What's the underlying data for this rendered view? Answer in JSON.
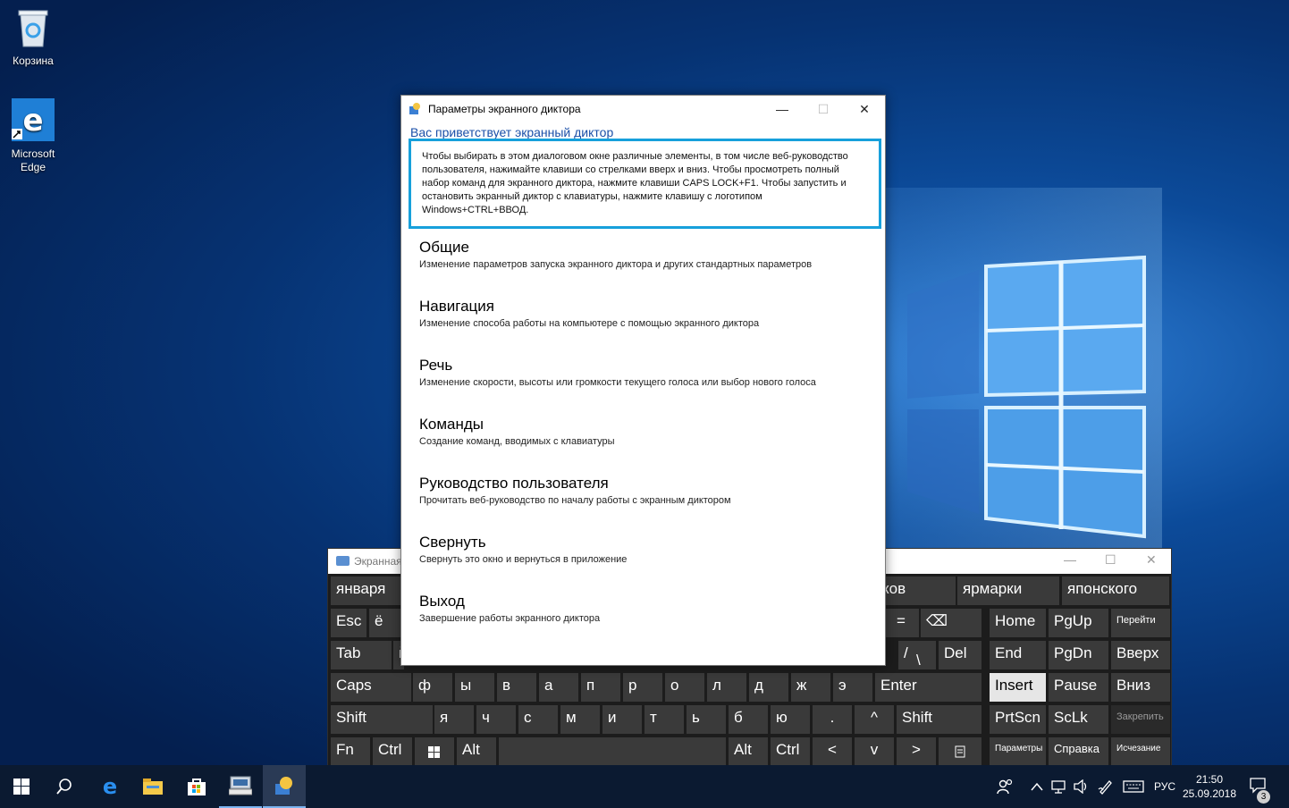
{
  "desktop": {
    "icons": [
      {
        "label": "Корзина"
      },
      {
        "label": "Microsoft Edge"
      }
    ]
  },
  "narrator": {
    "title": "Параметры экранного диктора",
    "welcome": "Вас приветствует экранный диктор",
    "intro": "Чтобы выбирать в этом диалоговом окне различные элементы, в том числе веб-руководство пользователя, нажимайте клавиши со стрелками вверх и вниз. Чтобы просмотреть полный набор команд для экранного диктора, нажмите клавиши CAPS LOCK+F1. Чтобы запустить и остановить экранный диктор с клавиатуры, нажмите клавишу с логотипом Windows+CTRL+ВВОД.",
    "items": [
      {
        "title": "Общие",
        "desc": "Изменение параметров запуска экранного диктора и других стандартных параметров"
      },
      {
        "title": "Навигация",
        "desc": "Изменение способа работы на компьютере с помощью экранного диктора"
      },
      {
        "title": "Речь",
        "desc": "Изменение скорости, высоты или громкости текущего голоса или выбор нового голоса"
      },
      {
        "title": "Команды",
        "desc": "Создание команд, вводимых с клавиатуры"
      },
      {
        "title": "Руководство пользователя",
        "desc": "Прочитать веб-руководство по началу работы с экранным диктором"
      },
      {
        "title": "Свернуть",
        "desc": "Свернуть это окно и вернуться в приложение"
      },
      {
        "title": "Выход",
        "desc": "Завершение работы экранного диктора"
      }
    ],
    "minimize": "—",
    "maximize": "☐",
    "close": "✕"
  },
  "keyboard": {
    "title": "Экранная",
    "predictions": [
      "января",
      "ков",
      "ярмарки",
      "японского"
    ],
    "row1": [
      "Esc",
      "ё",
      "=",
      "⌫"
    ],
    "row2": [
      "Tab",
      "й",
      "/",
      "\\",
      "Del"
    ],
    "row3": [
      "Caps",
      "ф",
      "ы",
      "в",
      "а",
      "п",
      "р",
      "о",
      "л",
      "д",
      "ж",
      "э",
      "Enter"
    ],
    "row4": [
      "Shift",
      "я",
      "ч",
      "с",
      "м",
      "и",
      "т",
      "ь",
      "б",
      "ю",
      ".",
      "^",
      "Shift"
    ],
    "row5": [
      "Fn",
      "Ctrl",
      "Alt",
      "Alt",
      "Ctrl",
      "<",
      "v",
      ">"
    ],
    "nav": {
      "home": "Home",
      "pgup": "PgUp",
      "goto": "Перейти",
      "end": "End",
      "pgdn": "PgDn",
      "up": "Вверх",
      "insert": "Insert",
      "pause": "Pause",
      "down": "Вниз",
      "prtscn": "PrtScn",
      "sclk": "ScLk",
      "pin": "Закрепить",
      "options": "Параметры",
      "help": "Справка",
      "fade": "Исчезание"
    }
  },
  "taskbar": {
    "lang": "РУС",
    "time": "21:50",
    "date": "25.09.2018",
    "notifications": "3"
  }
}
